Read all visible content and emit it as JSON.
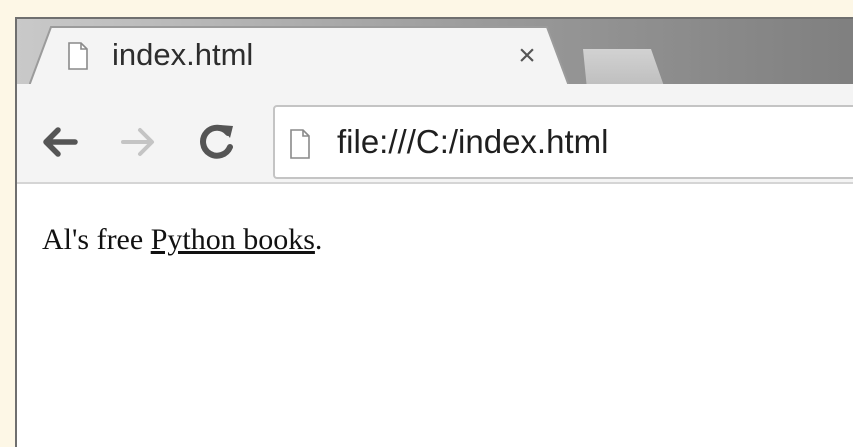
{
  "browser": {
    "tab": {
      "title": "index.html",
      "close_glyph": "×",
      "icon": "page-icon"
    },
    "toolbar": {
      "back_icon": "back-arrow-icon",
      "forward_icon": "forward-arrow-icon",
      "reload_icon": "reload-icon",
      "url": "file:///C:/index.html"
    }
  },
  "page": {
    "text_before": "Al's free ",
    "link_text": "Python books",
    "text_after": "."
  },
  "colors": {
    "background": "#fdf7e6",
    "tab_active": "#f4f4f4",
    "tab_strip": "#8f8f8f",
    "icon_dark": "#555555",
    "icon_disabled": "#c4c4c4"
  }
}
